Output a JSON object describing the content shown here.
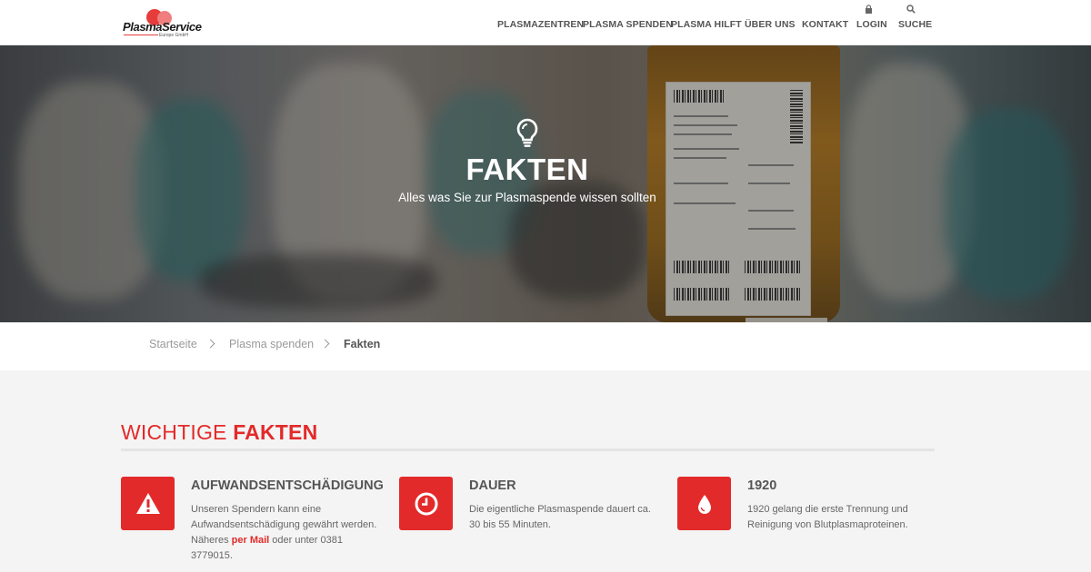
{
  "logo": {
    "name": "PlasmaService",
    "sub": "Europe GmbH"
  },
  "nav": {
    "items": [
      {
        "label": "PLASMAZENTREN"
      },
      {
        "label": "PLASMA SPENDEN"
      },
      {
        "label": "PLASMA HILFT"
      },
      {
        "label": "ÜBER UNS"
      },
      {
        "label": "KONTAKT"
      },
      {
        "label": "LOGIN",
        "icon": "lock-icon"
      },
      {
        "label": "SUCHE",
        "icon": "search-icon"
      }
    ]
  },
  "hero": {
    "icon": "lightbulb-icon",
    "title": "FAKTEN",
    "subtitle": "Alles was Sie zur Plasmaspende wissen sollten"
  },
  "breadcrumb": [
    "Startseite",
    "Plasma spenden",
    "Fakten"
  ],
  "facts_section": {
    "title_light": "WICHTIGE ",
    "title_bold": "FAKTEN",
    "items": [
      {
        "icon": "warning-icon",
        "title": "AUFWANDSENTSCHÄDIGUNG",
        "text_before": "Unseren Spendern kann eine Aufwandsentschädigung gewährt werden. Näheres ",
        "link": "per Mail",
        "text_after": " oder unter 0381 3779015."
      },
      {
        "icon": "clock-icon",
        "title": "DAUER",
        "text": "Die eigentliche Plasmaspende dauert ca. 30 bis 55 Minuten."
      },
      {
        "icon": "drop-icon",
        "title": "1920",
        "text": "1920 gelang die erste Trennung und Reinigung von Blutplasmaproteinen."
      }
    ]
  },
  "colors": {
    "accent": "#e32a2a",
    "header_bg": "#ffffff",
    "page_bg": "#f4f4f4"
  }
}
